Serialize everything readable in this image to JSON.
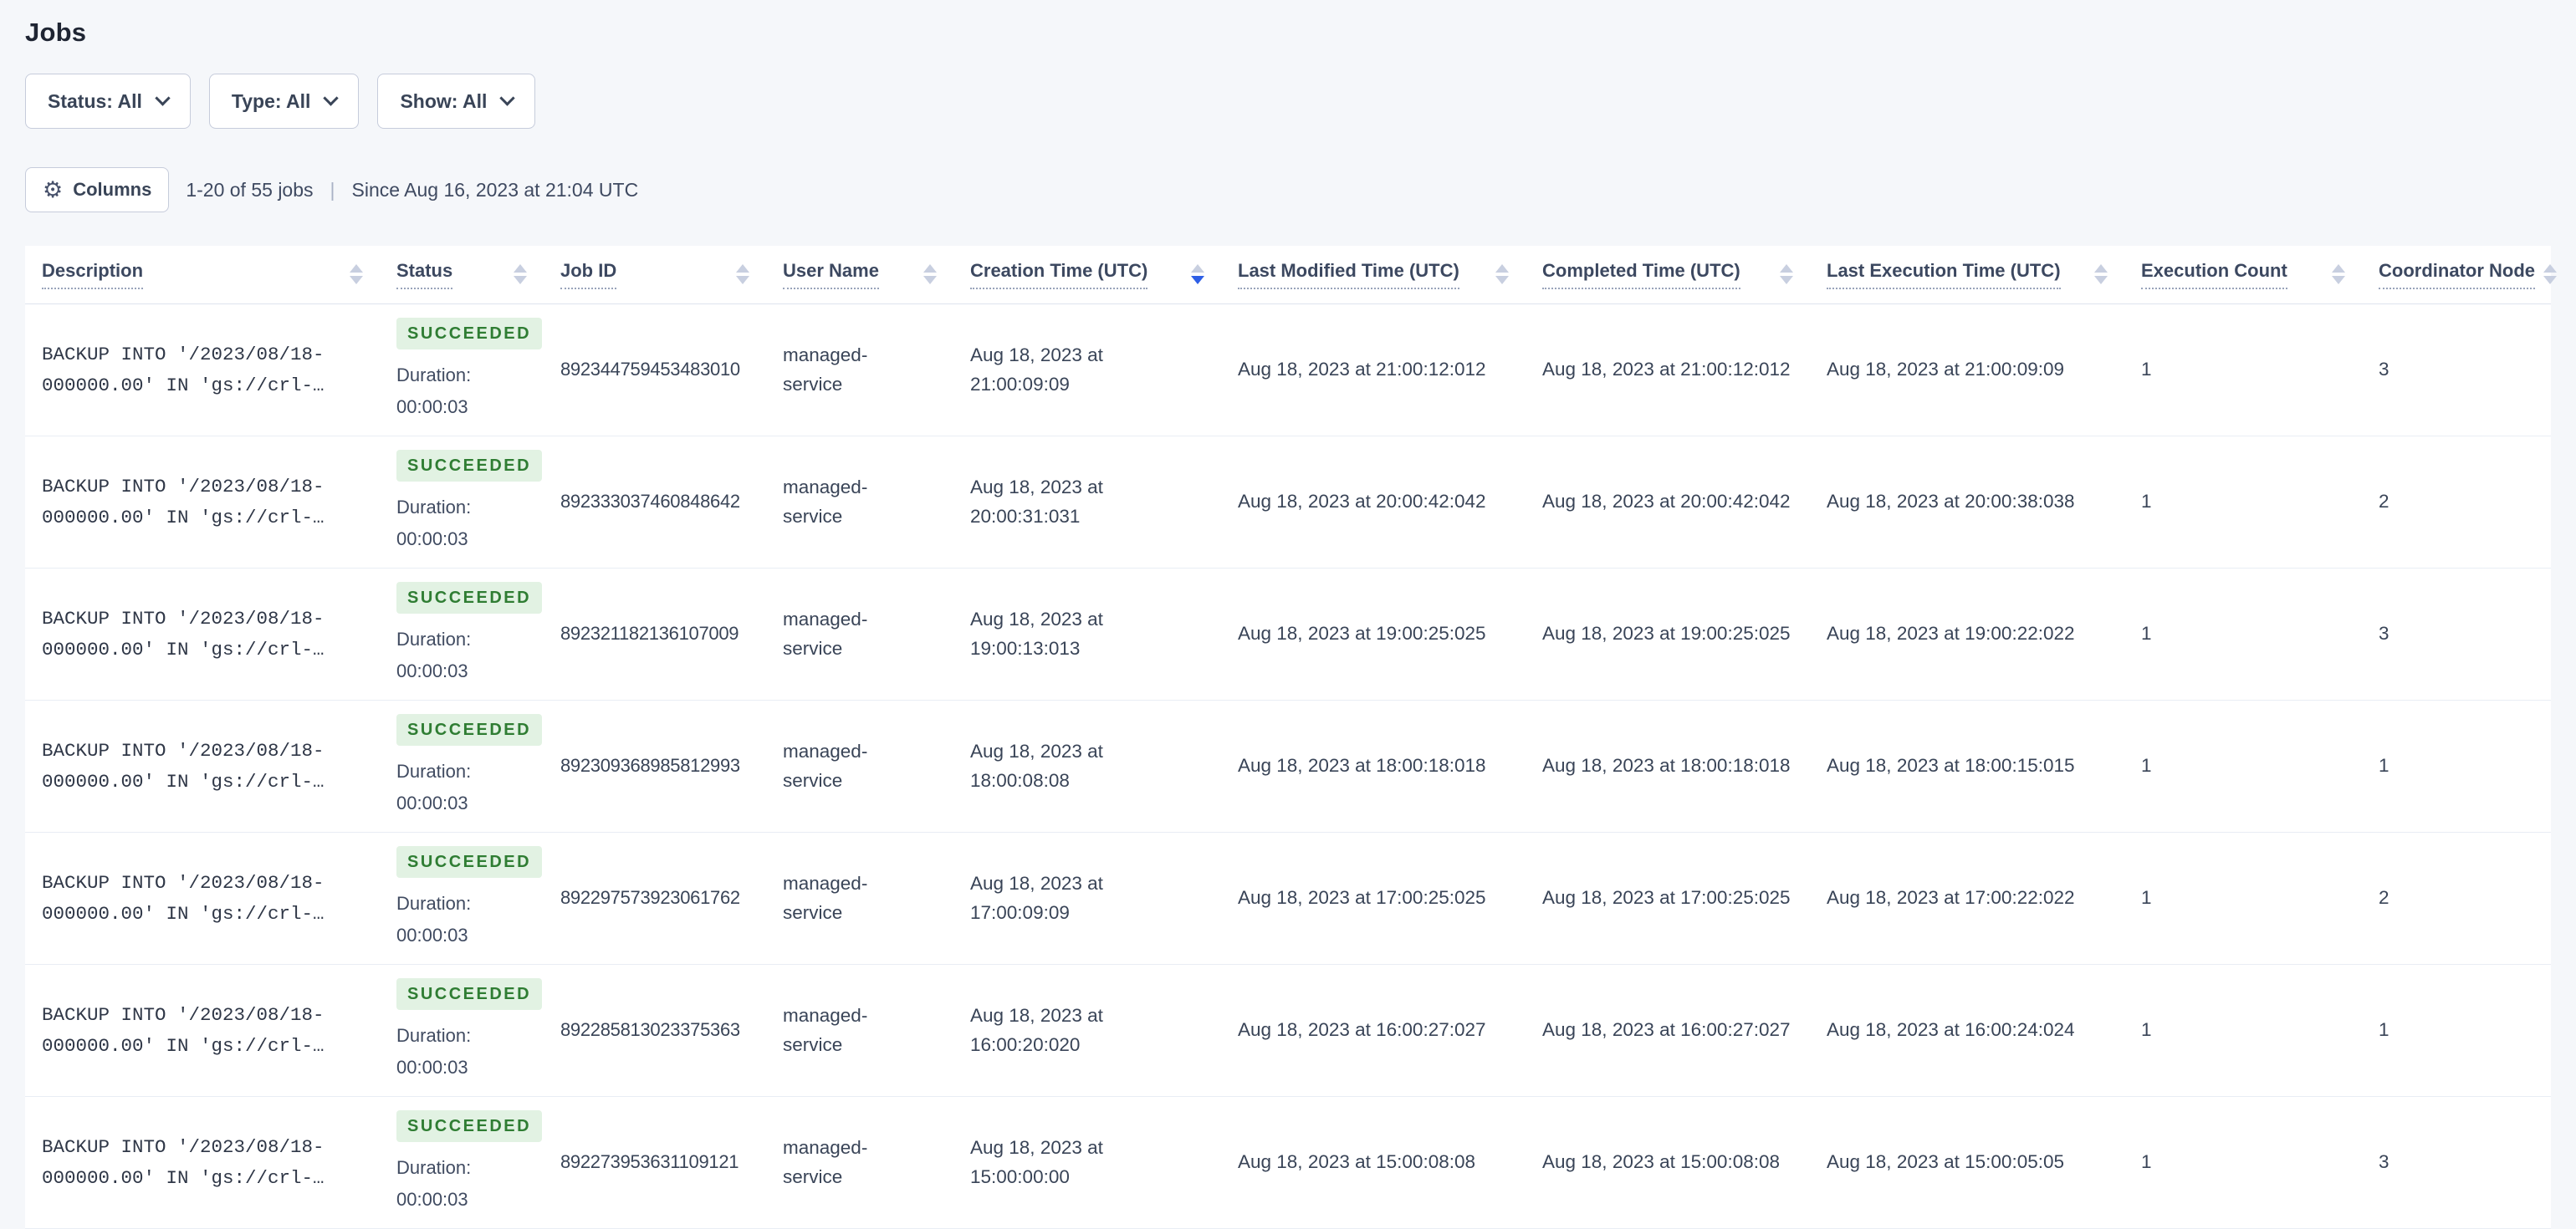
{
  "page": {
    "title": "Jobs"
  },
  "colors": {
    "page_bg": "#f5f7fa",
    "accent_sort_blue": "#2e5fe6",
    "badge_green_bg": "#e2f2e3",
    "badge_green_text": "#2f7d33"
  },
  "filters": [
    {
      "label": "Status: All"
    },
    {
      "label": "Type: All"
    },
    {
      "label": "Show: All"
    }
  ],
  "toolbar": {
    "columns_label": "Columns",
    "results_summary": "1-20 of 55 jobs",
    "separator": "|",
    "since": "Since Aug 16, 2023 at 21:04 UTC"
  },
  "table": {
    "columns": [
      {
        "label": "Description",
        "sort": "none"
      },
      {
        "label": "Status",
        "sort": "none"
      },
      {
        "label": "Job ID",
        "sort": "none"
      },
      {
        "label": "User Name",
        "sort": "none"
      },
      {
        "label": "Creation Time (UTC)",
        "sort": "desc"
      },
      {
        "label": "Last Modified Time (UTC)",
        "sort": "none"
      },
      {
        "label": "Completed Time (UTC)",
        "sort": "none"
      },
      {
        "label": "Last Execution Time (UTC)",
        "sort": "none"
      },
      {
        "label": "Execution Count",
        "sort": "none"
      },
      {
        "label": "Coordinator Node",
        "sort": "none"
      }
    ],
    "rows": [
      {
        "description": "BACKUP INTO '/2023/08/18-\n000000.00' IN 'gs://crl-…",
        "status": "SUCCEEDED",
        "duration_label": "Duration:",
        "duration_value": "00:00:03",
        "job_id": "892344759453483010",
        "user_name": "managed-\nservice",
        "creation_time": "Aug 18, 2023 at\n21:00:09:09",
        "last_modified_time": "Aug 18, 2023 at 21:00:12:012",
        "completed_time": "Aug 18, 2023 at 21:00:12:012",
        "last_execution_time": "Aug 18, 2023 at 21:00:09:09",
        "execution_count": "1",
        "coordinator_node": "3"
      },
      {
        "description": "BACKUP INTO '/2023/08/18-\n000000.00' IN 'gs://crl-…",
        "status": "SUCCEEDED",
        "duration_label": "Duration:",
        "duration_value": "00:00:03",
        "job_id": "892333037460848642",
        "user_name": "managed-\nservice",
        "creation_time": "Aug 18, 2023 at\n20:00:31:031",
        "last_modified_time": "Aug 18, 2023 at 20:00:42:042",
        "completed_time": "Aug 18, 2023 at 20:00:42:042",
        "last_execution_time": "Aug 18, 2023 at 20:00:38:038",
        "execution_count": "1",
        "coordinator_node": "2"
      },
      {
        "description": "BACKUP INTO '/2023/08/18-\n000000.00' IN 'gs://crl-…",
        "status": "SUCCEEDED",
        "duration_label": "Duration:",
        "duration_value": "00:00:03",
        "job_id": "892321182136107009",
        "user_name": "managed-\nservice",
        "creation_time": "Aug 18, 2023 at\n19:00:13:013",
        "last_modified_time": "Aug 18, 2023 at 19:00:25:025",
        "completed_time": "Aug 18, 2023 at 19:00:25:025",
        "last_execution_time": "Aug 18, 2023 at 19:00:22:022",
        "execution_count": "1",
        "coordinator_node": "3"
      },
      {
        "description": "BACKUP INTO '/2023/08/18-\n000000.00' IN 'gs://crl-…",
        "status": "SUCCEEDED",
        "duration_label": "Duration:",
        "duration_value": "00:00:03",
        "job_id": "892309368985812993",
        "user_name": "managed-\nservice",
        "creation_time": "Aug 18, 2023 at\n18:00:08:08",
        "last_modified_time": "Aug 18, 2023 at 18:00:18:018",
        "completed_time": "Aug 18, 2023 at 18:00:18:018",
        "last_execution_time": "Aug 18, 2023 at 18:00:15:015",
        "execution_count": "1",
        "coordinator_node": "1"
      },
      {
        "description": "BACKUP INTO '/2023/08/18-\n000000.00' IN 'gs://crl-…",
        "status": "SUCCEEDED",
        "duration_label": "Duration:",
        "duration_value": "00:00:03",
        "job_id": "892297573923061762",
        "user_name": "managed-\nservice",
        "creation_time": "Aug 18, 2023 at\n17:00:09:09",
        "last_modified_time": "Aug 18, 2023 at 17:00:25:025",
        "completed_time": "Aug 18, 2023 at 17:00:25:025",
        "last_execution_time": "Aug 18, 2023 at 17:00:22:022",
        "execution_count": "1",
        "coordinator_node": "2"
      },
      {
        "description": "BACKUP INTO '/2023/08/18-\n000000.00' IN 'gs://crl-…",
        "status": "SUCCEEDED",
        "duration_label": "Duration:",
        "duration_value": "00:00:03",
        "job_id": "892285813023375363",
        "user_name": "managed-\nservice",
        "creation_time": "Aug 18, 2023 at\n16:00:20:020",
        "last_modified_time": "Aug 18, 2023 at 16:00:27:027",
        "completed_time": "Aug 18, 2023 at 16:00:27:027",
        "last_execution_time": "Aug 18, 2023 at 16:00:24:024",
        "execution_count": "1",
        "coordinator_node": "1"
      },
      {
        "description": "BACKUP INTO '/2023/08/18-\n000000.00' IN 'gs://crl-…",
        "status": "SUCCEEDED",
        "duration_label": "Duration:",
        "duration_value": "00:00:03",
        "job_id": "892273953631109121",
        "user_name": "managed-\nservice",
        "creation_time": "Aug 18, 2023 at\n15:00:00:00",
        "last_modified_time": "Aug 18, 2023 at 15:00:08:08",
        "completed_time": "Aug 18, 2023 at 15:00:08:08",
        "last_execution_time": "Aug 18, 2023 at 15:00:05:05",
        "execution_count": "1",
        "coordinator_node": "3"
      }
    ]
  }
}
